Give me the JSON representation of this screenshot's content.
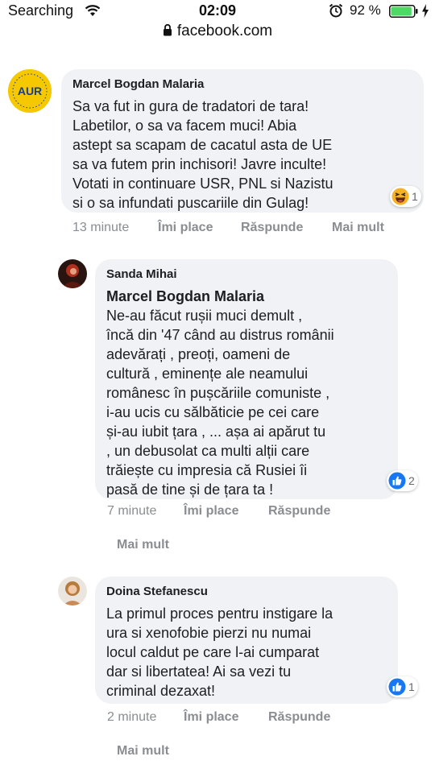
{
  "status_bar": {
    "carrier": "Searching",
    "time": "02:09",
    "battery_percent": "92 %",
    "battery_level": 0.92,
    "icons": [
      "wifi-icon",
      "alarm-icon",
      "battery-icon",
      "charging-bolt-icon"
    ]
  },
  "url_bar": {
    "url": "facebook.com",
    "icon": "lock-icon"
  },
  "colors": {
    "bubble_bg": "#f0f2f5",
    "meta_text": "#8a8d91",
    "like_blue": "#1877f2",
    "battery_green": "#4cd964"
  },
  "comments": [
    {
      "author": "Marcel Bogdan Malaria",
      "avatar_label": "AUR",
      "text": "Sa va fut in gura de tradatori de tara!\nLabetilor, o sa va facem muci! Abia\nastept sa scapam de cacatul asta de UE\nsa va futem prin inchisori! Javre inculte!\nVotati in continuare USR, PNL si Nazistu\nsi o sa infundati puscariile din Gulag!",
      "reaction_icon": "haha-reaction-icon",
      "reaction_count": "1",
      "time": "13 minute",
      "like_label": "Îmi place",
      "reply_label": "Răspunde",
      "more_label": "Mai mult"
    },
    {
      "author": "Sanda Mihai",
      "reply_to": "Marcel Bogdan Malaria",
      "text": "Ne-au făcut rușii muci demult ,\nîncă din '47 când au distrus românii\nadevărați , preoți, oameni de\ncultură , eminențe ale neamului\nromânesc în pușcăriile comuniste ,\ni-au ucis cu sălbăticie pe cei care\nși-au iubit țara , ... așa ai apărut tu\n, un debusolat ca multi alții care\ntrăiește cu impresia că Rusiei îi\npasă de tine și de țara ta !",
      "reaction_icon": "like-reaction-icon",
      "reaction_count": "2",
      "time": "7 minute",
      "like_label": "Îmi place",
      "reply_label": "Răspunde",
      "more_label": "Mai mult"
    },
    {
      "author": "Doina Stefanescu",
      "text": "La primul proces pentru instigare la\nura si xenofobie pierzi nu numai\nlocul caldut pe care l-ai cumparat\ndar si libertatea! Ai sa vezi tu\ncriminal dezaxat!",
      "reaction_icon": "like-reaction-icon",
      "reaction_count": "1",
      "time": "2 minute",
      "like_label": "Îmi place",
      "reply_label": "Răspunde",
      "more_label": "Mai mult"
    }
  ]
}
